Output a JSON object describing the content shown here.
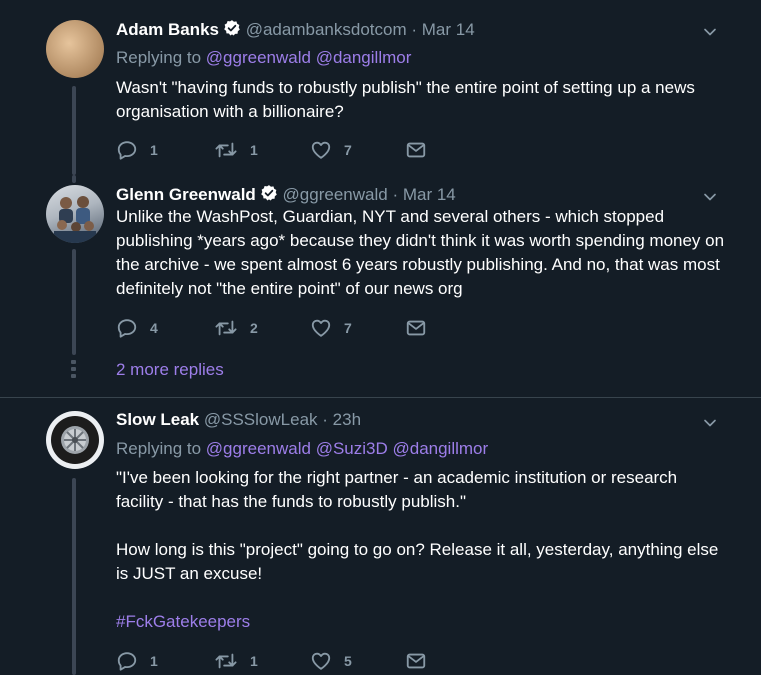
{
  "tweets": [
    {
      "name": "Adam Banks",
      "handle": "@adambanksdotcom",
      "date": "Mar 14",
      "replying_label": "Replying to",
      "replying_to": [
        "@ggreenwald",
        "@dangillmor"
      ],
      "text": "Wasn't \"having funds to robustly publish\" the entire point of setting up a news organisation with a billionaire?",
      "replies": "1",
      "retweets": "1",
      "likes": "7"
    },
    {
      "name": "Glenn Greenwald",
      "handle": "@ggreenwald",
      "date": "Mar 14",
      "text": "Unlike the WashPost, Guardian, NYT and several others - which stopped publishing *years ago* because they didn't think it was worth spending money on the archive - we spent almost 6 years robustly publishing. And no, that was most definitely not \"the entire point\" of our news org",
      "replies": "4",
      "retweets": "2",
      "likes": "7",
      "more_replies": "2 more replies"
    },
    {
      "name": "Slow Leak",
      "handle": "@SSSlowLeak",
      "date": "23h",
      "replying_label": "Replying to",
      "replying_to": [
        "@ggreenwald",
        "@Suzi3D",
        "@dangillmor"
      ],
      "text_p1": "\"I've been looking for the right partner - an academic institution or research facility - that has the funds to robustly publish.\"",
      "text_p2": "How long is this \"project\" going to go on? Release it all, yesterday, anything else is JUST an excuse!",
      "hashtag": "#FckGatekeepers",
      "replies": "1",
      "retweets": "1",
      "likes": "5"
    }
  ],
  "separator": "·",
  "icons": {
    "verified": "verified-badge-icon",
    "caret": "chevron-down-icon",
    "reply": "reply-icon",
    "retweet": "retweet-icon",
    "like": "heart-icon",
    "dm": "envelope-icon"
  },
  "colors": {
    "background": "#141d26",
    "secondary_text": "#8899a6",
    "link": "#9d7ee9",
    "divider": "#38444d"
  }
}
